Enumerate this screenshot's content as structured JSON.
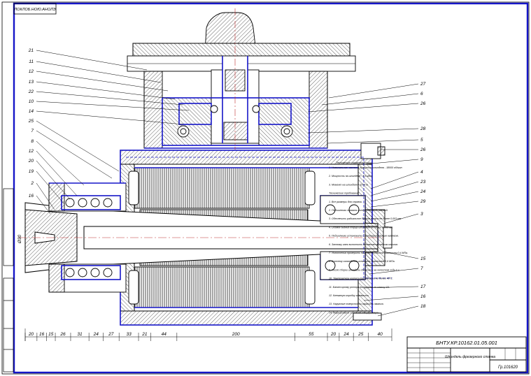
{
  "stamp_top": "ЛОКЛОБ.НОЮ.АНОЛЭ",
  "title_block": {
    "doc_number": "БНТУ.КР.10162.01.05.001",
    "name": "Шпиндель фрезерного станка",
    "group": "Гр.101620"
  },
  "notes": {
    "heading": "Технические характеристики",
    "lines": [
      "1. Номинальная частота вращения шпинделя - 18000 об/мин",
      "2. Мощность на шпинделе - 5,5 кВт",
      "3. Момент на шпинделе - 15 Н·м",
      "Технические требования",
      "1. Все размеры для справок.",
      "2. Подшипники смазать консистентной смазкой.",
      "3. Обеспечить радиальное биение конуса не более 0,003 мм.",
      "4. Осевое биение торца шпинделя не более 0,003 мм.",
      "5. Подшипники установить с предварительным натягом.",
      "6. Затяжку гаек выполнить динамометрическим ключом.",
      "7. Уплотнения проверить на герметичность давлением 0,4 МПа.",
      "8. Систему охлаждения испытать давлением 0,6 МПа.",
      "9. После сборки шпиндель обкатать на холостом ходу 2 ч.",
      "10. Температура корпуса при обкатке не более 40°С.",
      "11. Балансировку ротора выполнить по классу G1.",
      "12. Клеммную коробку заземлить.",
      "13. Наружные поверхности окрасить эмалью.",
      "14. Маркировать согласно спецификации."
    ]
  },
  "callouts_left": [
    "21",
    "11",
    "12",
    "13",
    "22",
    "10",
    "14",
    "25",
    "7",
    "8",
    "12",
    "20",
    "19",
    "2",
    "16"
  ],
  "callouts_right": [
    "27",
    "6",
    "26",
    "28",
    "5",
    "26",
    "9",
    "4",
    "23",
    "24",
    "29",
    "3",
    "15",
    "7",
    "17",
    "16",
    "18"
  ],
  "dimensions_bottom": [
    "20",
    "16",
    "15",
    "26",
    "31",
    "24",
    "27",
    "33",
    "21",
    "44",
    "200",
    "55",
    "20",
    "24",
    "25",
    "40"
  ],
  "dim_left": "Ø30"
}
